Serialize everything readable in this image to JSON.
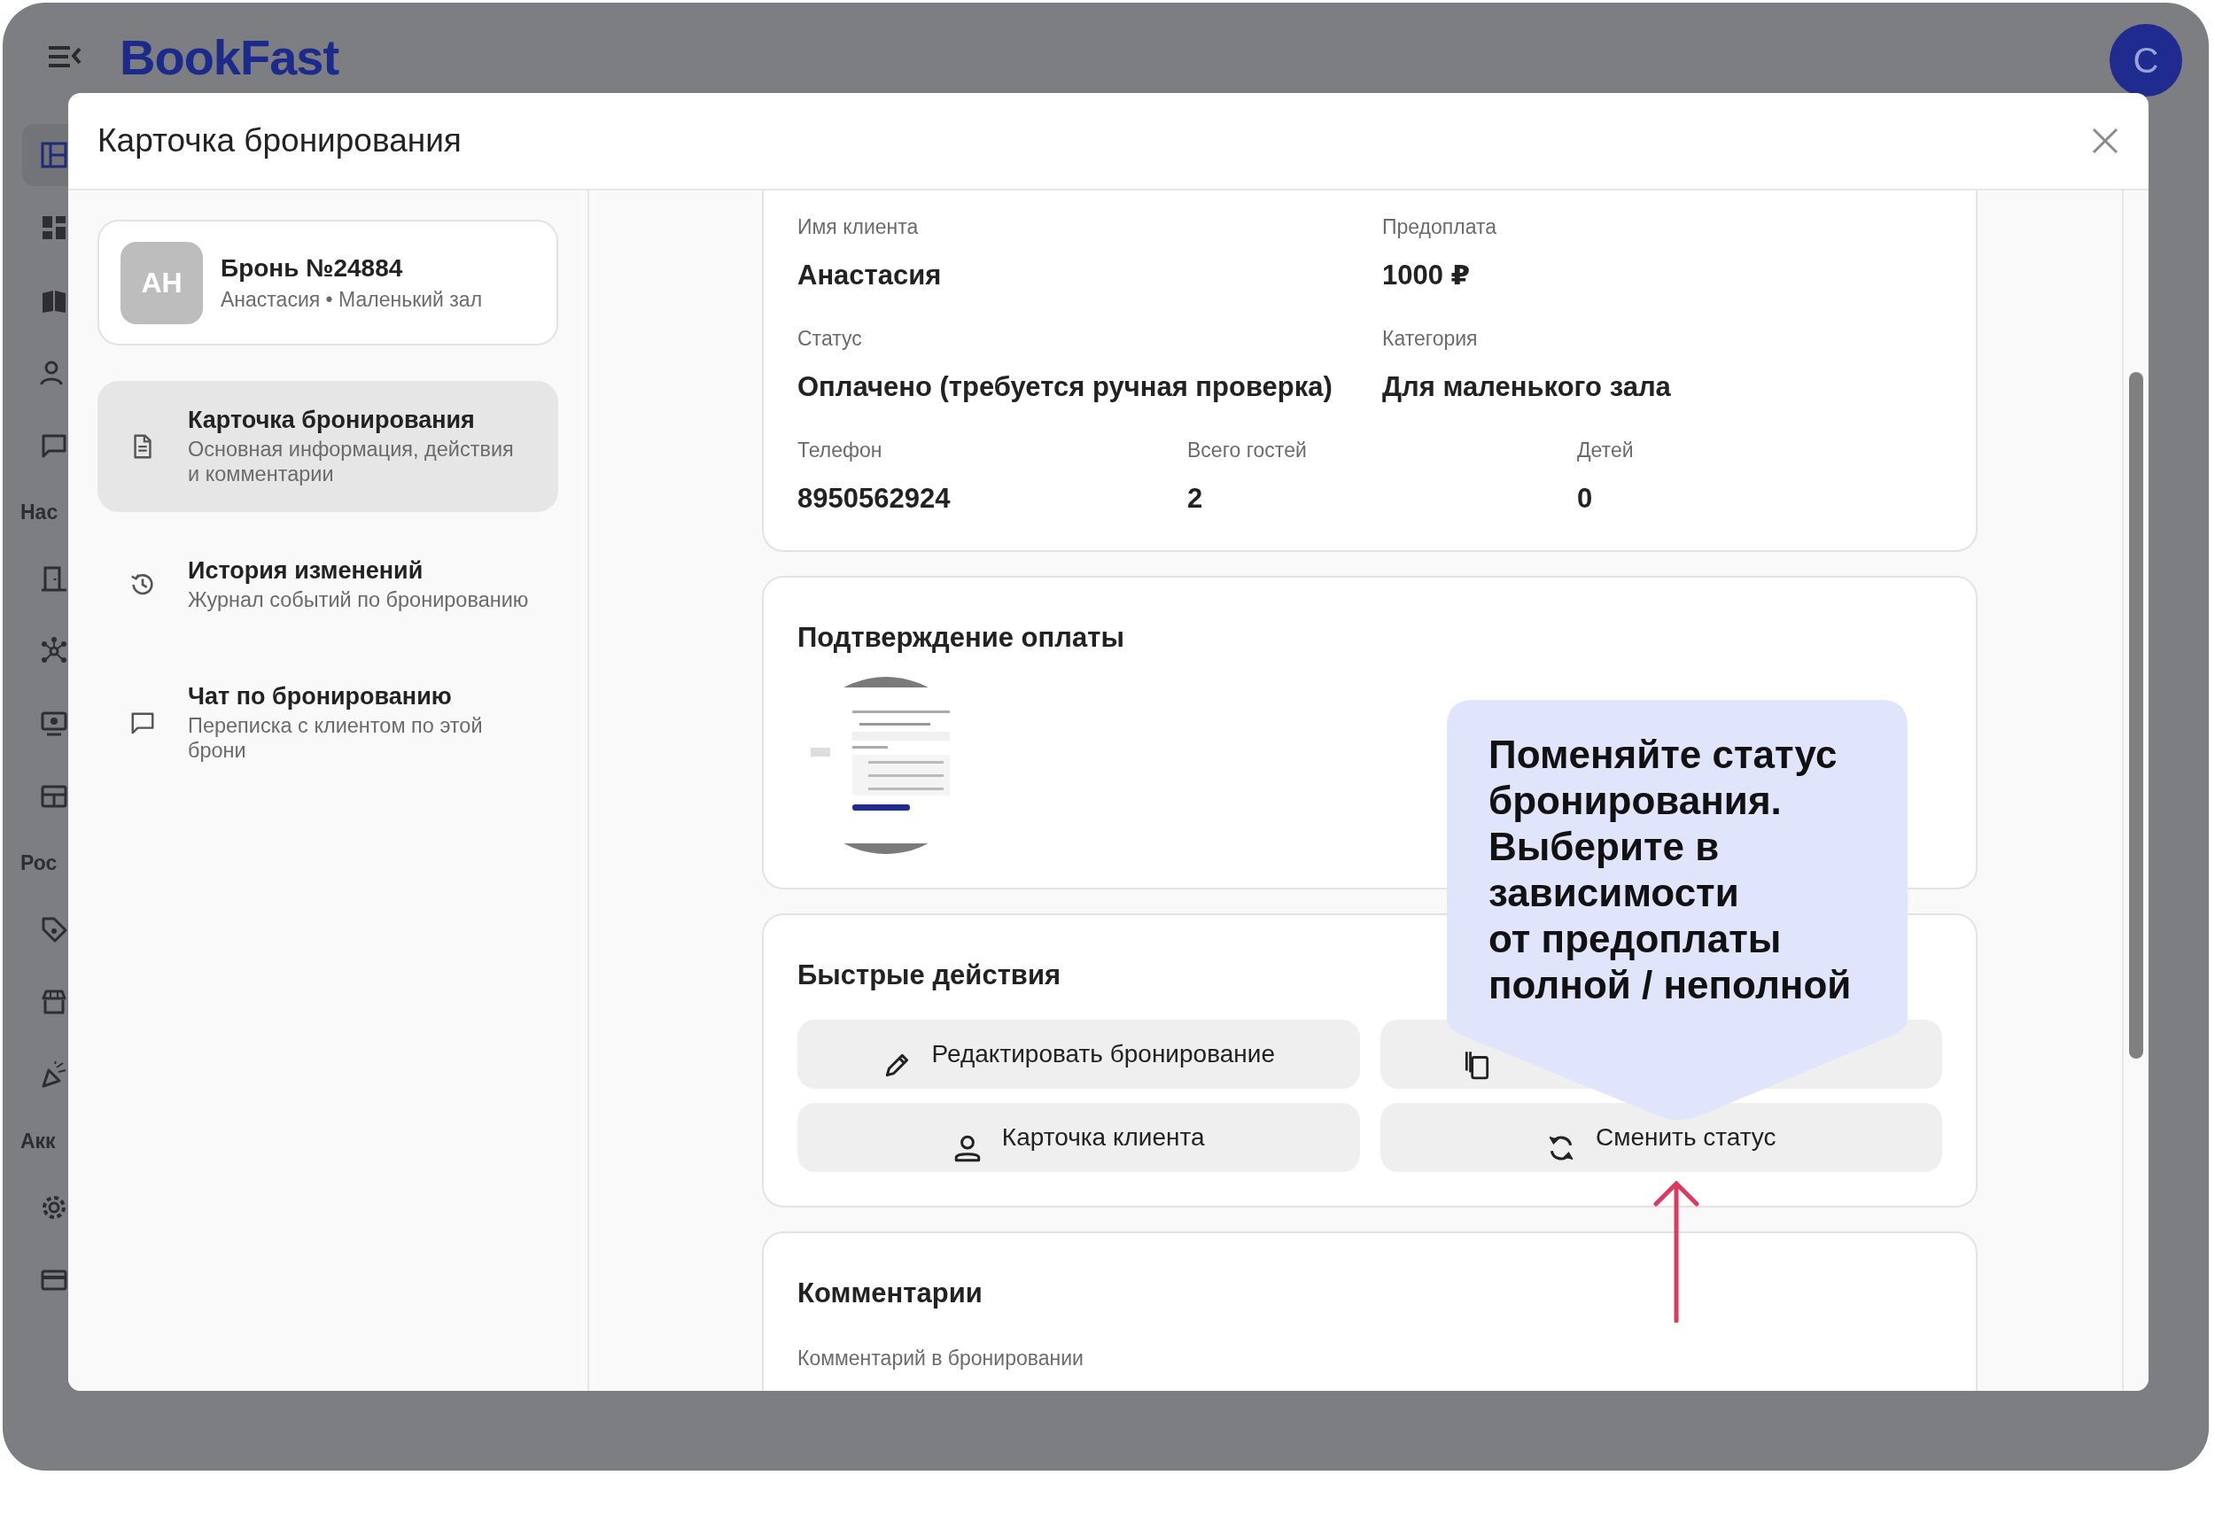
{
  "topbar": {
    "logo": "BookFast",
    "avatar": "C"
  },
  "rail": [
    {
      "kind": "item",
      "selected": true
    },
    {
      "kind": "item",
      "selected": false
    },
    {
      "kind": "item",
      "selected": false
    },
    {
      "kind": "item",
      "selected": false
    },
    {
      "kind": "item",
      "selected": false
    },
    {
      "kind": "heading",
      "text": "Нас"
    },
    {
      "kind": "item",
      "selected": false
    },
    {
      "kind": "item",
      "selected": false
    },
    {
      "kind": "item",
      "selected": false
    },
    {
      "kind": "item",
      "selected": false
    },
    {
      "kind": "heading",
      "text": "Рос"
    },
    {
      "kind": "item",
      "selected": false
    },
    {
      "kind": "item",
      "selected": false
    },
    {
      "kind": "item",
      "selected": false
    },
    {
      "kind": "heading",
      "text": "Акк"
    },
    {
      "kind": "item",
      "selected": false
    },
    {
      "kind": "item",
      "selected": false
    }
  ],
  "modal": {
    "title": "Карточка бронирования",
    "booking": {
      "initials": "АН",
      "title": "Бронь №24884",
      "subtitle": "Анастасия • Маленький зал"
    },
    "nav": [
      {
        "title": "Карточка бронирования",
        "description": "Основная информация, действия и комментарии",
        "selected": true
      },
      {
        "title": "История изменений",
        "description": "Журнал событий по бронированию",
        "selected": false
      },
      {
        "title": "Чат по бронированию",
        "description": "Переписка с клиентом по этой брони",
        "selected": false
      }
    ],
    "details": {
      "rows": [
        [
          {
            "label": "Имя клиента",
            "value": "Анастасия"
          },
          {
            "label": "Предоплата",
            "value": "1000 ₽"
          }
        ],
        [
          {
            "label": "Статус",
            "value": "Оплачено (требуется ручная проверка)"
          },
          {
            "label": "Категория",
            "value": "Для маленького зала"
          }
        ],
        [
          {
            "label": "Телефон",
            "value": "8950562924"
          },
          {
            "label": "Всего гостей",
            "value": "2"
          },
          {
            "label": "Детей",
            "value": "0"
          }
        ]
      ]
    },
    "payment": {
      "title": "Подтверждение оплаты"
    },
    "actions": {
      "title": "Быстрые действия",
      "buttons": [
        {
          "kind": "edit",
          "label": "Редактировать бронирование"
        },
        {
          "kind": "copy"
        },
        {
          "kind": "client",
          "label": "Карточка клиента"
        },
        {
          "kind": "status",
          "label": "Сменить статус"
        }
      ]
    },
    "comments": {
      "title": "Комментарии",
      "field_label": "Комментарий в бронировании"
    },
    "tooltip": {
      "text": "Поменяйте статус\nбронирования.\nВыберите в\nзависимости\nот предоплаты\nполной / неполной"
    }
  }
}
